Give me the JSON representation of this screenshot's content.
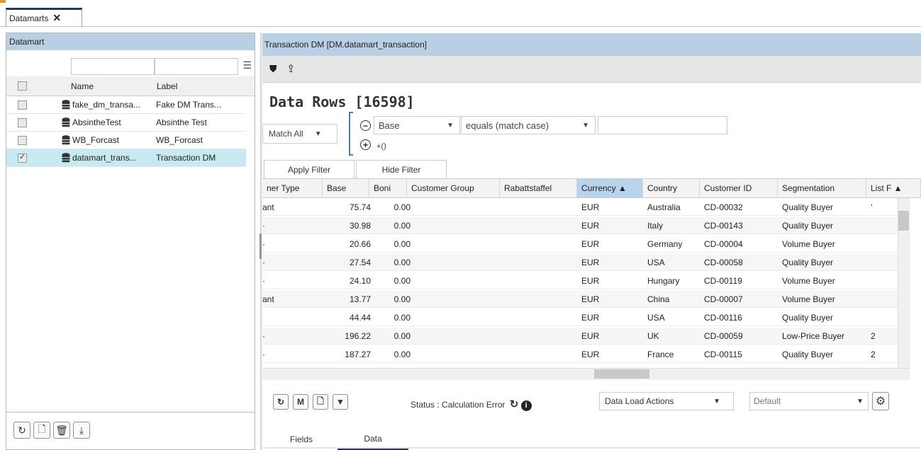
{
  "top_tab": {
    "label": "Datamarts",
    "close": "✕"
  },
  "left_panel": {
    "title": "Datamart",
    "columns": {
      "name": "Name",
      "label": "Label"
    },
    "rows": [
      {
        "name": "fake_dm_transa...",
        "label": "Fake DM Trans...",
        "checked": false,
        "selected": false
      },
      {
        "name": "AbsintheTest",
        "label": "Absinthe Test",
        "checked": false,
        "selected": false
      },
      {
        "name": "WB_Forcast",
        "label": "WB_Forcast",
        "checked": false,
        "selected": false
      },
      {
        "name": "datamart_trans...",
        "label": "Transaction DM",
        "checked": true,
        "selected": true
      }
    ],
    "bottom_icons": [
      "refresh-icon",
      "add-file-icon",
      "trash-icon",
      "download-icon"
    ]
  },
  "right_panel": {
    "title": "Transaction DM  [DM.datamart_transaction]",
    "data_title": "Data Rows [16598]",
    "filter": {
      "match": "Match All",
      "field": "Base",
      "operator": "equals (match case)",
      "value": "",
      "plus_label": "+()",
      "apply_label": "Apply Filter",
      "hide_label": "Hide Filter"
    },
    "columns": [
      "ner Type",
      "Base",
      "Boni",
      "Customer Group",
      "Rabattstaffel",
      "Currency ▲",
      "Country",
      "Customer ID",
      "Segmentation",
      "List F ▲"
    ],
    "rows": [
      [
        "ant",
        "75.74",
        "0.00",
        "",
        "",
        "EUR",
        "Australia",
        "CD-00032",
        "Quality Buyer",
        "‘"
      ],
      [
        "·",
        "30.98",
        "0.00",
        "",
        "",
        "EUR",
        "Italy",
        "CD-00143",
        "Quality Buyer",
        ""
      ],
      [
        "·",
        "20.66",
        "0.00",
        "",
        "",
        "EUR",
        "Germany",
        "CD-00004",
        "Volume Buyer",
        ""
      ],
      [
        "·",
        "27.54",
        "0.00",
        "",
        "",
        "EUR",
        "USA",
        "CD-00058",
        "Quality Buyer",
        ""
      ],
      [
        "·",
        "24.10",
        "0.00",
        "",
        "",
        "EUR",
        "Hungary",
        "CD-00119",
        "Volume Buyer",
        ""
      ],
      [
        "ant",
        "13.77",
        "0.00",
        "",
        "",
        "EUR",
        "China",
        "CD-00007",
        "Volume Buyer",
        ""
      ],
      [
        "",
        "44.44",
        "0.00",
        "",
        "",
        "EUR",
        "USA",
        "CD-00116",
        "Quality Buyer",
        ""
      ],
      [
        "·",
        "196.22",
        "0.00",
        "",
        "",
        "EUR",
        "UK",
        "CD-00059",
        "Low-Price Buyer",
        "2"
      ],
      [
        "·",
        "187.27",
        "0.00",
        "",
        "",
        "EUR",
        "France",
        "CD-00115",
        "Quality Buyer",
        "2"
      ]
    ],
    "status": "Status : Calculation Error",
    "data_load_actions": "Data Load Actions",
    "default_select": "Default",
    "bottom_tabs": [
      "Fields",
      "Data"
    ]
  }
}
